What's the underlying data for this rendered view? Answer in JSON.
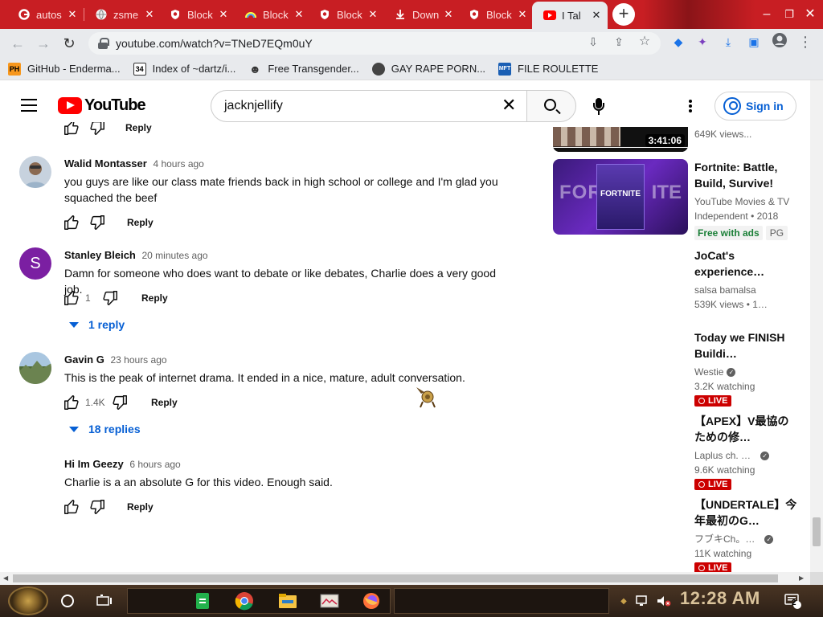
{
  "browser": {
    "tabs": [
      {
        "title": "autos",
        "favicon": "google-icon",
        "active": false
      },
      {
        "title": "zsme",
        "favicon": "globe-icon",
        "active": false
      },
      {
        "title": "Block",
        "favicon": "shield-icon",
        "active": false
      },
      {
        "title": "Block",
        "favicon": "rainbow-icon",
        "active": false
      },
      {
        "title": "Block",
        "favicon": "shield-icon",
        "active": false
      },
      {
        "title": "Down",
        "favicon": "download-icon",
        "active": false
      },
      {
        "title": "Block",
        "favicon": "shield-icon",
        "active": false
      },
      {
        "title": "I Tal",
        "favicon": "youtube-icon",
        "active": true
      }
    ],
    "tab_close": "✕",
    "url": "youtube.com/watch?v=TNeD7EQm0uY",
    "bookmarks": [
      {
        "label": "GitHub - Enderma...",
        "icon": "PH",
        "color": "#f7971d"
      },
      {
        "label": "Index of ~dartz/i...",
        "icon": "34",
        "color": "#333333"
      },
      {
        "label": "Free Transgender...",
        "icon": "mask-icon",
        "color": "#555555"
      },
      {
        "label": "GAY RAPE PORN...",
        "icon": "globe-icon",
        "color": "#444444"
      },
      {
        "label": "FILE ROULETTE",
        "icon": "MFT",
        "color": "#1a5fb4"
      }
    ],
    "accent": "#c81e23"
  },
  "youtube": {
    "logo_text": "YouTube",
    "search_value": "jacknjellify",
    "sign_in_label": "Sign in",
    "top_reply_label": "Reply",
    "comments": [
      {
        "author": "Walid Montasser",
        "time": "4 hours ago",
        "text": "you guys are like our class mate friends back in high school or college and I'm glad you squached the beef",
        "likes": "",
        "reply_label": "Reply",
        "replies": ""
      },
      {
        "author": "Stanley Bleich",
        "time": "20 minutes ago",
        "text": "Damn for someone who does want to debate or like debates, Charlie does a very good job.",
        "likes": "1",
        "reply_label": "Reply",
        "replies": "1 reply",
        "avatar_letter": "S"
      },
      {
        "author": "Gavin G",
        "time": "23 hours ago",
        "text": "This is the peak of internet drama. It ended in a nice, mature, adult conversation.",
        "likes": "1.4K",
        "reply_label": "Reply",
        "replies": "18 replies"
      },
      {
        "author": "Hi Im Geezy",
        "time": "6 hours ago",
        "text": "Charlie is a an absolute G for this video. Enough said.",
        "likes": "",
        "reply_label": "Reply",
        "replies": ""
      }
    ],
    "sidebar": {
      "top": {
        "views": "649K views...",
        "duration": "3:41:06"
      },
      "items": [
        {
          "title": "Fortnite: Battle, Build, Survive!",
          "meta1": "YouTube Movies & TV",
          "meta2": "Independent • 2018",
          "badge": "Free with ads",
          "badge2": "PG",
          "thumb_text": "FORTNITE"
        },
        {
          "title": "JoCat's experience…",
          "meta1": "salsa bamalsa",
          "meta2": "539K views • 1…"
        },
        {
          "title": "Today we FINISH Buildi…",
          "meta1": "Westie",
          "meta2": "3.2K watching",
          "live": "LIVE"
        },
        {
          "title": "【APEX】V最協のための修…",
          "meta1": "Laplus ch. …",
          "meta2": "9.6K watching",
          "live": "LIVE"
        },
        {
          "title": "【UNDERTALE】今年最初のG…",
          "meta1": "フブキCh。…",
          "meta2": "11K watching",
          "live": "LIVE"
        }
      ]
    }
  },
  "taskbar": {
    "clock": "12:28 AM",
    "notif_count": "2"
  }
}
